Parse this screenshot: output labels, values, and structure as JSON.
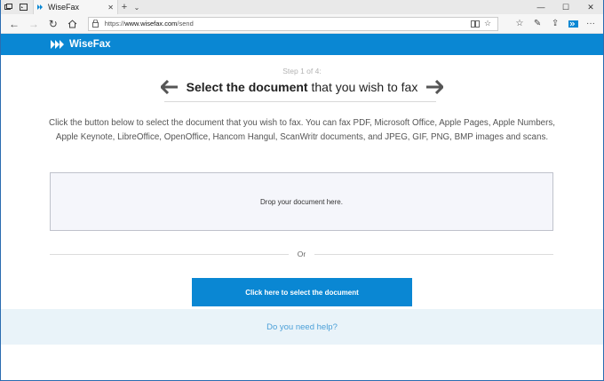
{
  "browser": {
    "tab_title": "WiseFax",
    "tab_close": "✕",
    "new_tab": "+",
    "url_prefix": "https://",
    "url_host": "www.wisefax.com",
    "url_path": "/send",
    "window_controls": {
      "minimize": "—",
      "maximize": "☐",
      "close": "✕"
    }
  },
  "site": {
    "logo_text": "WiseFax",
    "brand_color": "#0a87d3"
  },
  "main": {
    "step": "Step 1 of 4:",
    "headline_bold": "Select the document",
    "headline_rest": " that you wish to fax",
    "description": "Click the button below to select the document that you wish to fax. You can fax PDF, Microsoft Office, Apple Pages, Apple Numbers, Apple Keynote, LibreOffice, OpenOffice, Hancom Hangul, ScanWritr documents, and JPEG, GIF, PNG, BMP images and scans.",
    "dropzone_text": "Drop your document here.",
    "or_text": "Or",
    "select_button": "Click here to select the document"
  },
  "footer": {
    "help_link": "Do you need help?"
  }
}
